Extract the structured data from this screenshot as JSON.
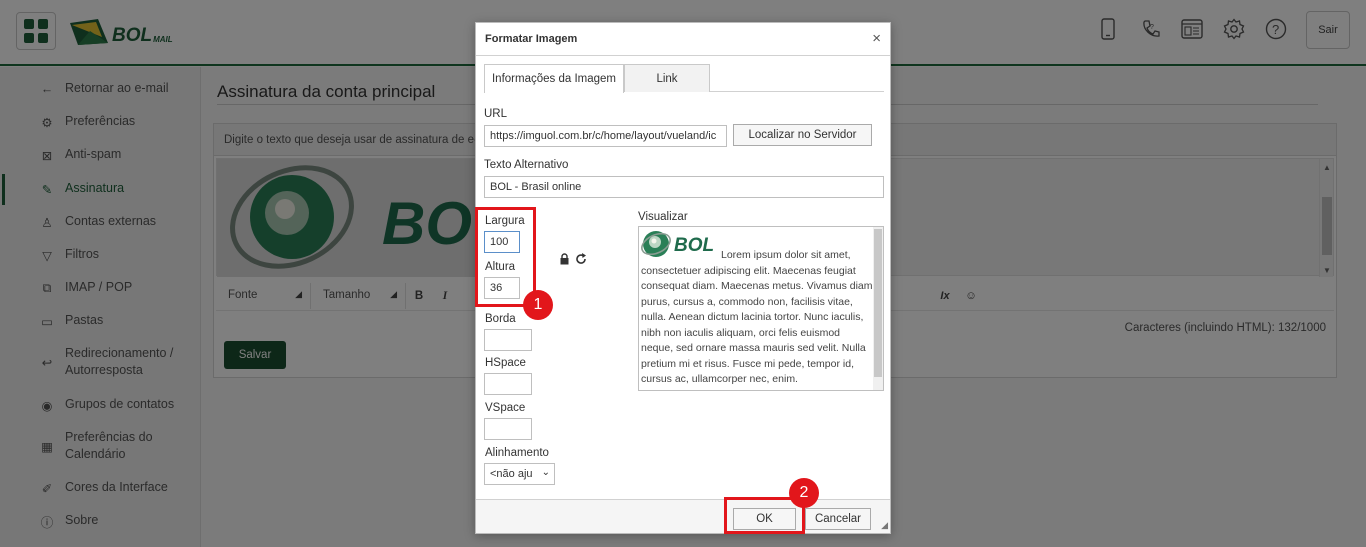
{
  "header": {
    "logo_text": "BOL",
    "logo_sub": "MAIL",
    "icons": [
      "mobile-icon",
      "help-phone-icon",
      "layout-icon",
      "gear-icon",
      "question-icon"
    ],
    "sair_label": "Sair"
  },
  "sidebar": {
    "items": [
      {
        "label": "Retornar ao e-mail",
        "icon": "arrow-left-icon"
      },
      {
        "label": "Preferências",
        "icon": "gear-icon"
      },
      {
        "label": "Anti-spam",
        "icon": "spam-icon"
      },
      {
        "label": "Assinatura",
        "icon": "pen-icon"
      },
      {
        "label": "Contas externas",
        "icon": "user-icon"
      },
      {
        "label": "Filtros",
        "icon": "filter-icon"
      },
      {
        "label": "IMAP / POP",
        "icon": "imap-icon"
      },
      {
        "label": "Pastas",
        "icon": "folder-icon"
      },
      {
        "label": "Redirecionamento /",
        "label2": "Autorresposta",
        "icon": "reply-icon"
      },
      {
        "label": "Grupos de contatos",
        "icon": "group-icon"
      },
      {
        "label": "Preferências do",
        "label2": "Calendário",
        "icon": "calendar-icon"
      },
      {
        "label": "Cores da Interface",
        "icon": "palette-icon"
      },
      {
        "label": "Sobre",
        "icon": "info-icon"
      }
    ],
    "active": "Assinatura"
  },
  "main": {
    "title": "Assinatura da conta principal",
    "hint": "Digite o texto que deseja usar de assinatura de e-m",
    "toolbar": {
      "font": "Fonte",
      "size": "Tamanho",
      "bold": "B",
      "italic": "I",
      "clear_format": "Ix",
      "emoji": "☺"
    },
    "counter": "Caracteres (incluindo HTML): 132/1000",
    "save_label": "Salvar"
  },
  "dialog": {
    "title": "Formatar Imagem",
    "close": "×",
    "tabs": [
      {
        "label": "Informações da Imagem",
        "active": true
      },
      {
        "label": "Link",
        "active": false
      }
    ],
    "url_label": "URL",
    "url_value": "https://imguol.com.br/c/home/layout/vueland/ic",
    "browse_label": "Localizar no Servidor",
    "alt_label": "Texto Alternativo",
    "alt_value": "BOL - Brasil online",
    "width_label": "Largura",
    "width_value": "100",
    "height_label": "Altura",
    "height_value": "36",
    "border_label": "Borda",
    "border_value": "",
    "hspace_label": "HSpace",
    "hspace_value": "",
    "vspace_label": "VSpace",
    "vspace_value": "",
    "align_label": "Alinhamento",
    "align_value": "<não aju",
    "preview_label": "Visualizar",
    "preview_logo": "BOL",
    "preview_text": "Lorem ipsum dolor sit amet, consectetuer adipiscing elit. Maecenas feugiat consequat diam. Maecenas metus. Vivamus diam purus, cursus a, commodo non, facilisis vitae, nulla. Aenean dictum lacinia tortor. Nunc iaculis, nibh non iaculis aliquam, orci felis euismod neque, sed ornare massa mauris sed velit. Nulla pretium mi et risus. Fusce mi pede, tempor id, cursus ac, ullamcorper nec, enim.",
    "ok_label": "OK",
    "cancel_label": "Cancelar"
  },
  "annotations": {
    "badge1": "1",
    "badge2": "2"
  },
  "colors": {
    "brand": "#1e5f3a",
    "highlight": "#e2161b",
    "save_button": "#1b4e31"
  }
}
